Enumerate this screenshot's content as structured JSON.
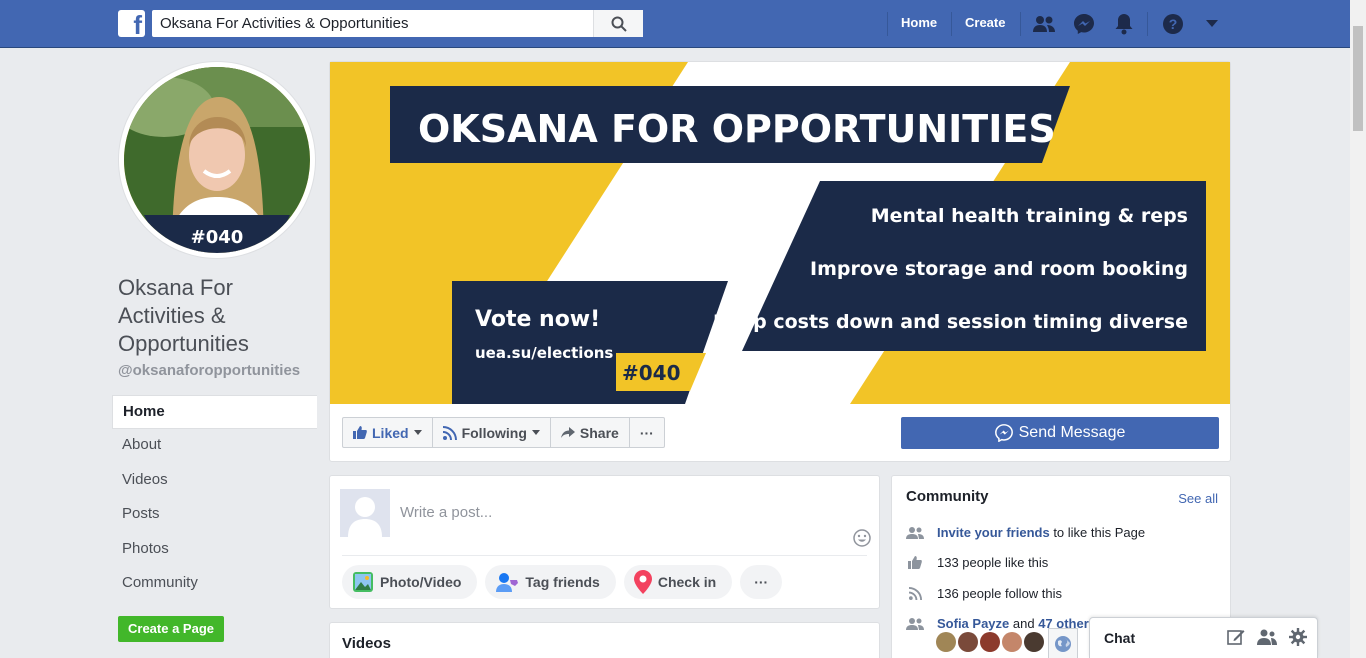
{
  "topbar": {
    "search_value": "Oksana For Activities & Opportunities",
    "home_label": "Home",
    "create_label": "Create"
  },
  "profile": {
    "badge_text": "#040",
    "name": "Oksana For Activities & Opportunities",
    "handle": "@oksanaforopportunities"
  },
  "side_nav": {
    "items": [
      "Home",
      "About",
      "Videos",
      "Posts",
      "Photos",
      "Community"
    ],
    "create_page_label": "Create a Page"
  },
  "cover": {
    "headline": "OKSANA FOR OPPORTUNITIES",
    "points": [
      "Mental health training & reps",
      "Improve storage and room booking",
      "Keep costs down and session timing diverse"
    ],
    "vote_text": "Vote now!",
    "vote_url": "uea.su/elections",
    "tag": "#040",
    "colors": {
      "yellow": "#f2c427",
      "navy": "#1b2a48",
      "white": "#ffffff"
    }
  },
  "actions": {
    "liked_label": "Liked",
    "following_label": "Following",
    "share_label": "Share",
    "more_label": "···",
    "send_message_label": "Send Message"
  },
  "composer": {
    "placeholder": "Write a post...",
    "photo_video_label": "Photo/Video",
    "tag_friends_label": "Tag friends",
    "check_in_label": "Check in",
    "more_label": "···"
  },
  "videos": {
    "title": "Videos"
  },
  "community": {
    "title": "Community",
    "see_all": "See all",
    "invite_link": "Invite your friends",
    "invite_rest": " to like this Page",
    "likes_text": "133 people like this",
    "follows_text": "136 people follow this",
    "friend_name": "Sofia Payze",
    "friend_and": " and ",
    "friend_others": "47 other"
  },
  "chat": {
    "label": "Chat"
  }
}
